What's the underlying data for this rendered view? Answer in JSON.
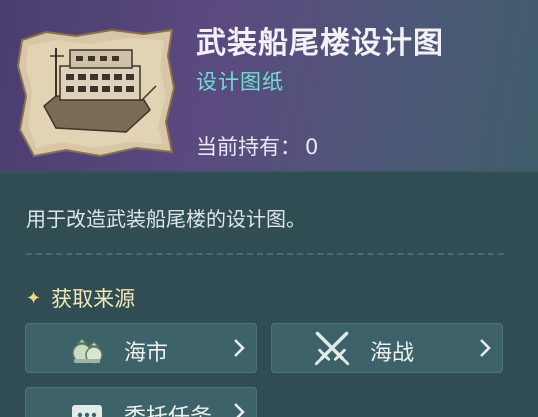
{
  "item": {
    "title": "武装船尾楼设计图",
    "subtype": "设计图纸",
    "owned_label": "当前持有：",
    "owned_count": "0",
    "description": "用于改造武装船尾楼的设计图。",
    "image_icon": "ship-blueprint-icon"
  },
  "sources": {
    "title": "获取来源",
    "title_icon": "sparkle-star-icon",
    "buttons": [
      {
        "label": "海市",
        "icon": "money-bags-icon"
      },
      {
        "label": "海战",
        "icon": "crossed-swords-icon"
      },
      {
        "label": "委托任务",
        "icon": "speech-bubble-icon"
      }
    ]
  },
  "colors": {
    "header_start": "#4a3d6e",
    "header_end": "#3f5d6a",
    "body": "#2f4d53",
    "subtype": "#6fe0d0",
    "section_title": "#f2e7b8",
    "button_bg": "#3d6269"
  }
}
